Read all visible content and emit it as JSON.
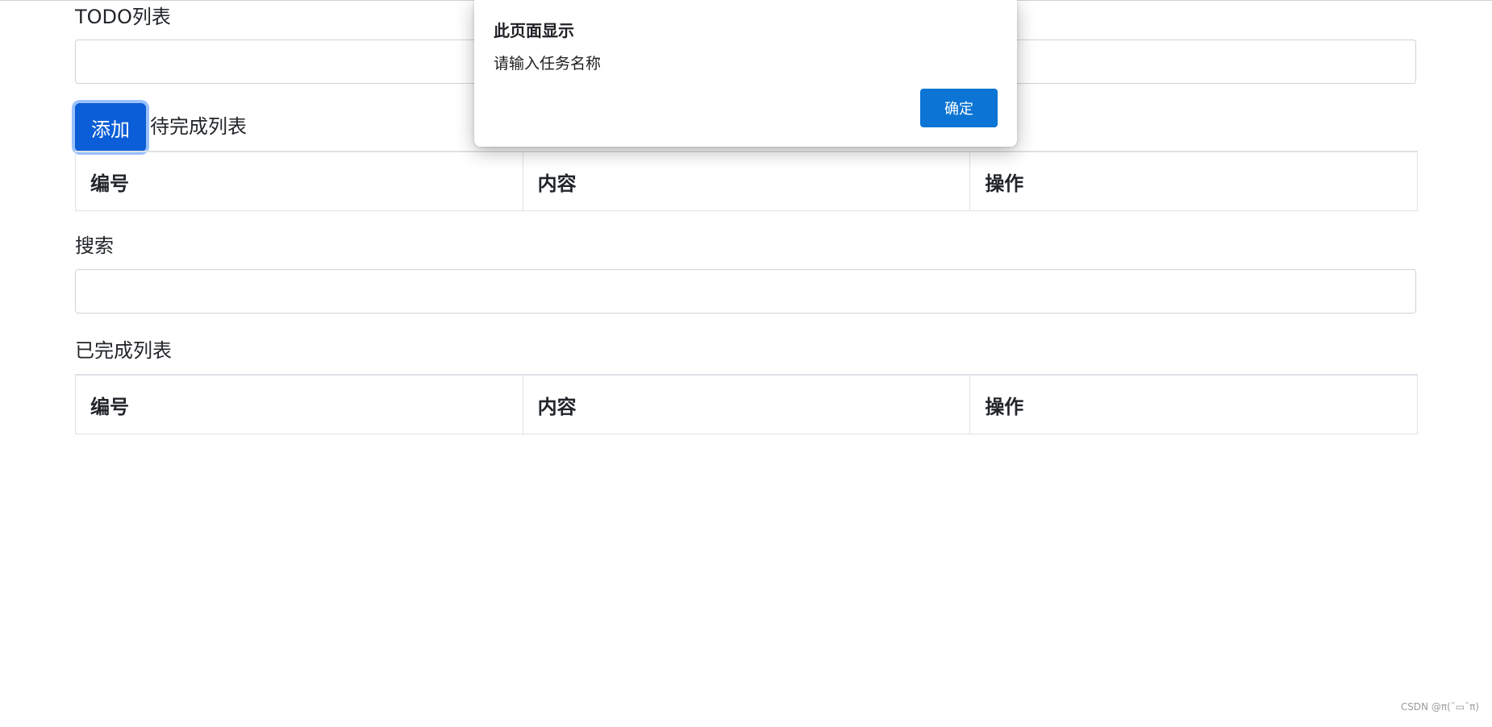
{
  "todo": {
    "label": "TODO列表",
    "input_value": "",
    "add_button_label": "添加"
  },
  "pending": {
    "label": "待完成列表",
    "columns": [
      "编号",
      "内容",
      "操作"
    ]
  },
  "search": {
    "label": "搜索",
    "input_value": ""
  },
  "done": {
    "label": "已完成列表",
    "columns": [
      "编号",
      "内容",
      "操作"
    ]
  },
  "dialog": {
    "title": "此页面显示",
    "message": "请输入任务名称",
    "ok_label": "确定"
  },
  "watermark": "CSDN @π(ˉ▭ˉπ)",
  "colors": {
    "primary_button": "#0b5ed7",
    "dialog_button": "#0b74d4",
    "border": "#dee2e6"
  }
}
